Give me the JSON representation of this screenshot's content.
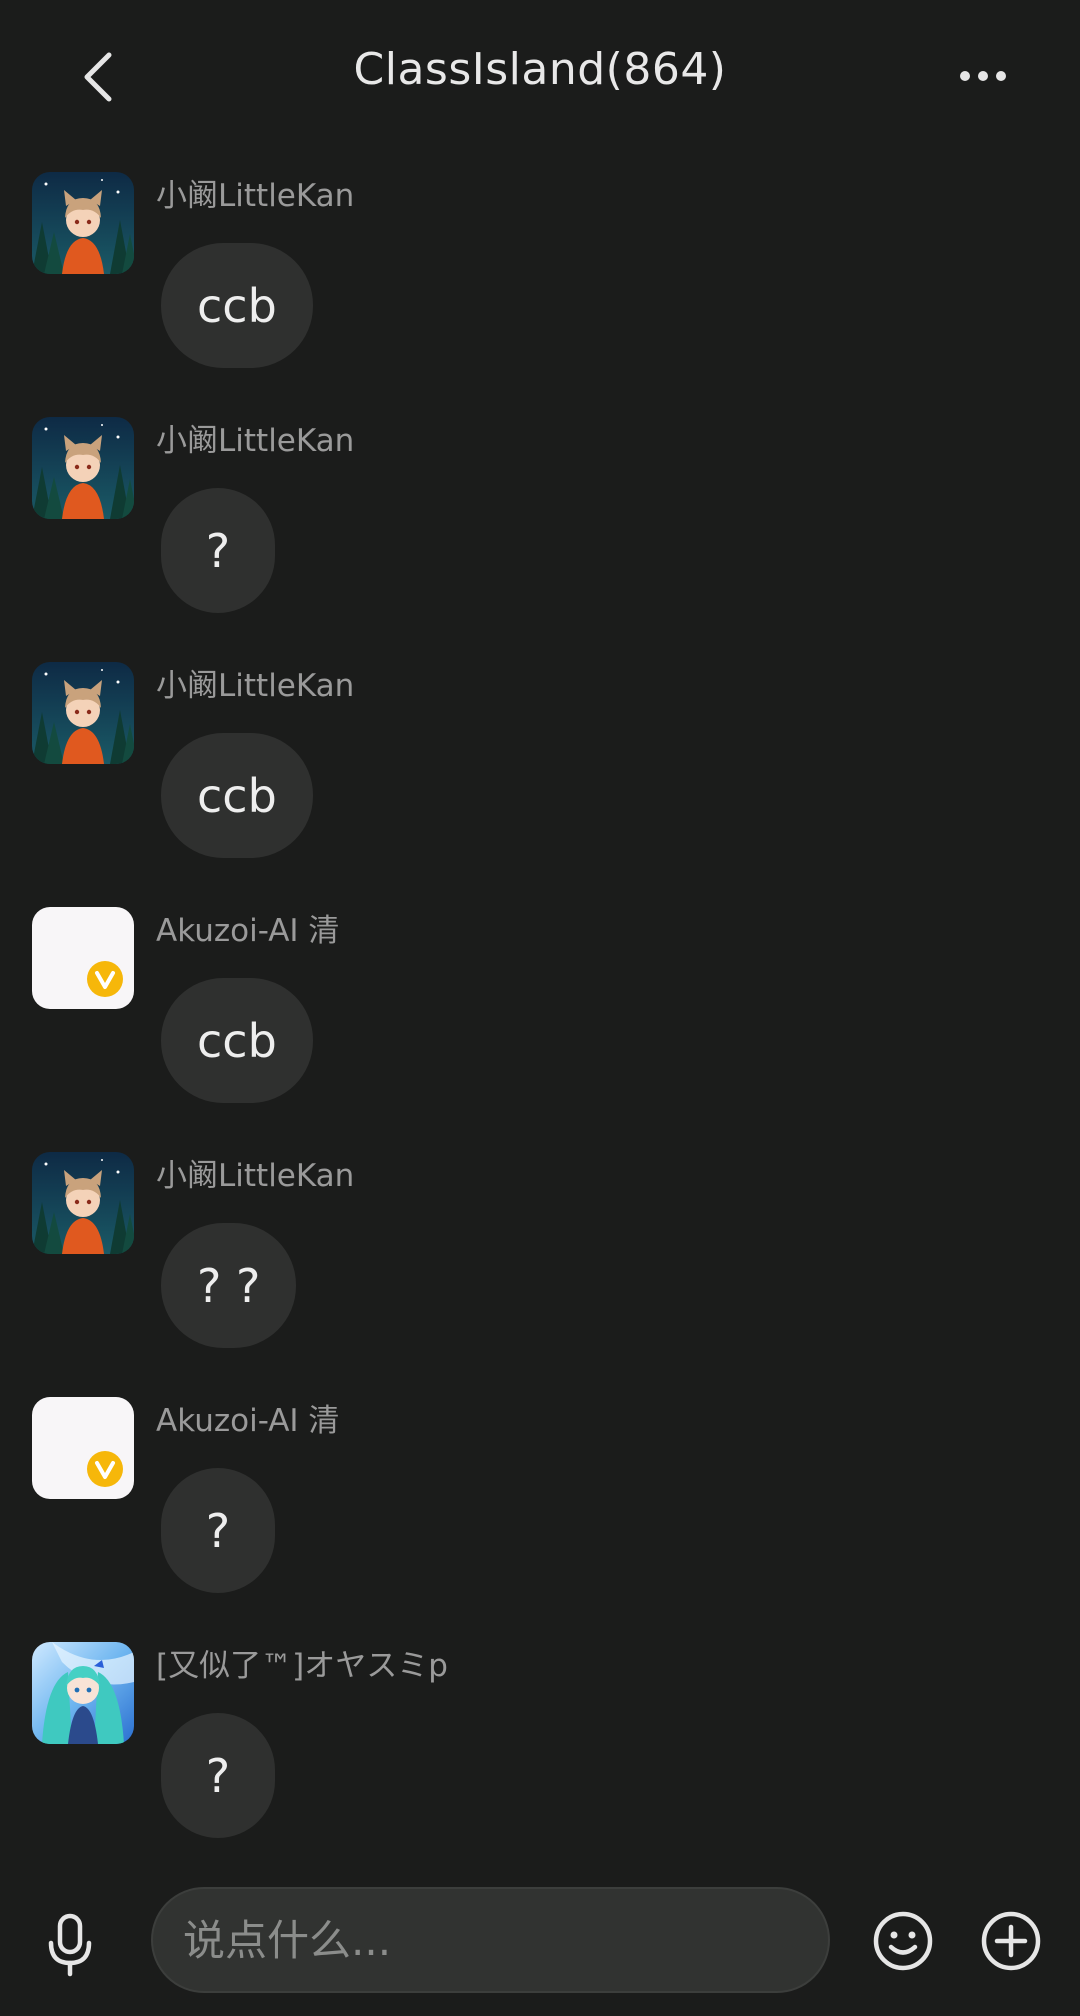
{
  "header": {
    "title": "ClassIsland(864)",
    "back_icon": "chevron-left-icon",
    "more_icon": "more-dots-icon"
  },
  "messages": [
    {
      "sender": "小阚LittleKan",
      "text": "ccb",
      "avatar": "catboy-avatar"
    },
    {
      "sender": "小阚LittleKan",
      "text": "?",
      "avatar": "catboy-avatar"
    },
    {
      "sender": "小阚LittleKan",
      "text": "ccb",
      "avatar": "catboy-avatar"
    },
    {
      "sender": "Akuzoi-AI 清",
      "text": "ccb",
      "avatar": "white-badge-avatar"
    },
    {
      "sender": "小阚LittleKan",
      "text": "? ?",
      "avatar": "catboy-avatar"
    },
    {
      "sender": "Akuzoi-AI 清",
      "text": "?",
      "avatar": "white-badge-avatar"
    },
    {
      "sender": "[又似了™]オヤスミp",
      "text": "?",
      "avatar": "anime-girl-avatar"
    }
  ],
  "composer": {
    "placeholder": "说点什么...",
    "mic_icon": "microphone-icon",
    "emoji_icon": "emoji-icon",
    "plus_icon": "plus-circle-icon"
  },
  "colors": {
    "background": "#1b1c1b",
    "bubble": "#2f302f",
    "sender_text": "#9a9a9a",
    "badge": "#f6b70a"
  }
}
